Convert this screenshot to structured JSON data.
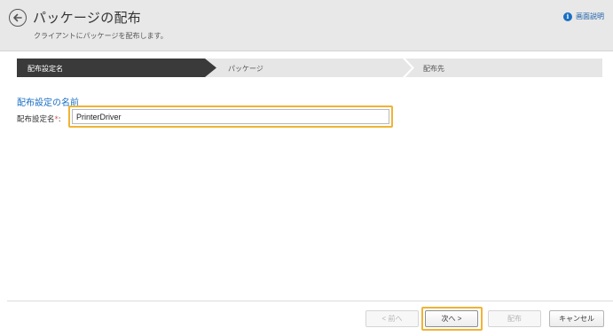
{
  "header": {
    "title": "パッケージの配布",
    "subtitle": "クライアントにパッケージを配布します。",
    "help_label": "画面説明"
  },
  "steps": [
    {
      "label": "配布設定名",
      "active": true
    },
    {
      "label": "パッケージ",
      "active": false
    },
    {
      "label": "配布先",
      "active": false
    }
  ],
  "form": {
    "section_title": "配布設定の名前",
    "field_label": "配布設定名",
    "required_mark": "*",
    "field_suffix": ":",
    "field_value": "PrinterDriver"
  },
  "buttons": {
    "prev_label": "< 前へ",
    "next_label": "次へ >",
    "deploy_label": "配布",
    "cancel_label": "キャンセル"
  },
  "colors": {
    "active_step": "#3a3a3a",
    "inactive_step": "#e6e6e6",
    "accent": "#1a6fc4",
    "highlight": "#f0b334",
    "required": "#d9534f"
  }
}
